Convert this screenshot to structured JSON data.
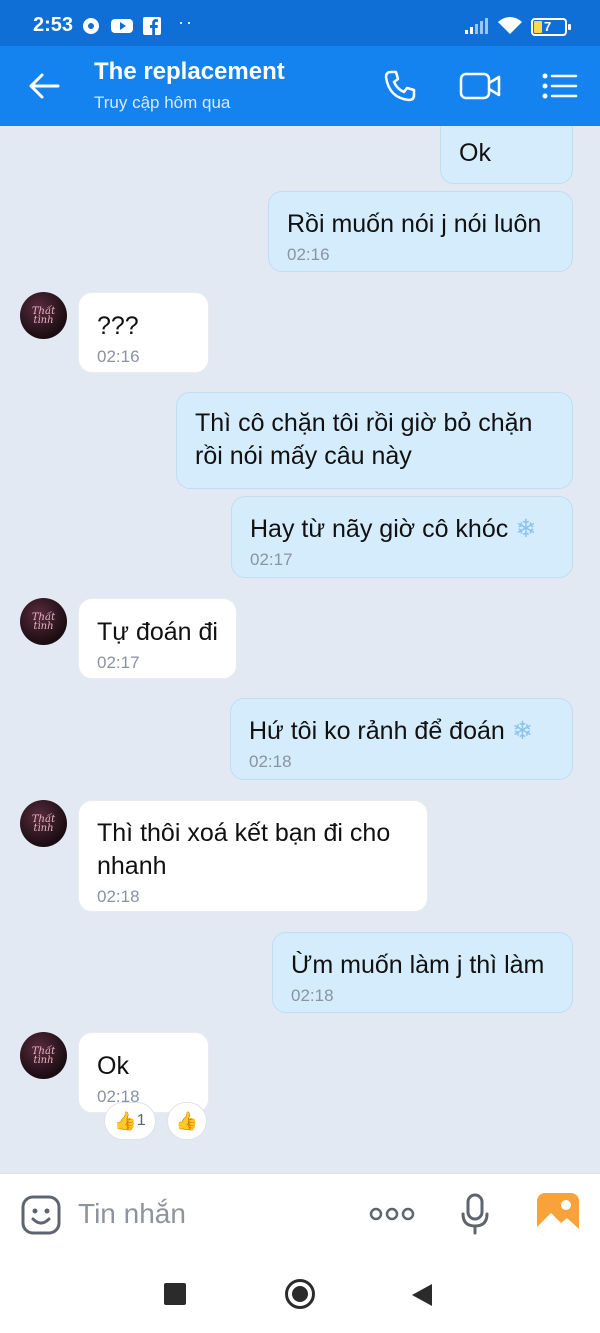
{
  "status_bar": {
    "time": "2:53",
    "battery": "7",
    "extra": "··"
  },
  "header": {
    "title": "The replacement",
    "subtitle": "Truy cập hôm qua",
    "back_icon": "arrow-left-icon",
    "call_icon": "phone-icon",
    "video_icon": "video-camera-icon",
    "menu_icon": "list-menu-icon"
  },
  "messages": [
    {
      "dir": "out",
      "text": "Ok",
      "time": ""
    },
    {
      "dir": "out",
      "text": "Rồi muốn nói j nói luôn",
      "time": "02:16"
    },
    {
      "dir": "in",
      "text": "???",
      "time": "02:16"
    },
    {
      "dir": "out",
      "text": "Thì cô chặn tôi rồi giờ bỏ chặn rồi nói mấy câu này",
      "time": ""
    },
    {
      "dir": "out",
      "text": "Hay từ nãy giờ cô khóc",
      "time": "02:17"
    },
    {
      "dir": "in",
      "text": "Tự đoán đi",
      "time": "02:17"
    },
    {
      "dir": "out",
      "text": "Hứ tôi ko rảnh để đoán",
      "time": "02:18"
    },
    {
      "dir": "in",
      "text": "Thì thôi xoá kết bạn đi cho nhanh",
      "time": "02:18"
    },
    {
      "dir": "out",
      "text": "Ừm muốn làm j thì làm",
      "time": "02:18"
    },
    {
      "dir": "in",
      "text": "Ok",
      "time": "02:18"
    }
  ],
  "reactions": {
    "count": "1"
  },
  "input": {
    "placeholder": "Tin nhắn",
    "more_label": "ooo"
  },
  "colors": {
    "header": "#1483f0",
    "status_bar": "#0f6fd6",
    "bubble_out": "#d5ecfd",
    "bubble_in": "#ffffff",
    "chat_bg": "#e3e9f2",
    "image_button": "#f7a23b"
  }
}
